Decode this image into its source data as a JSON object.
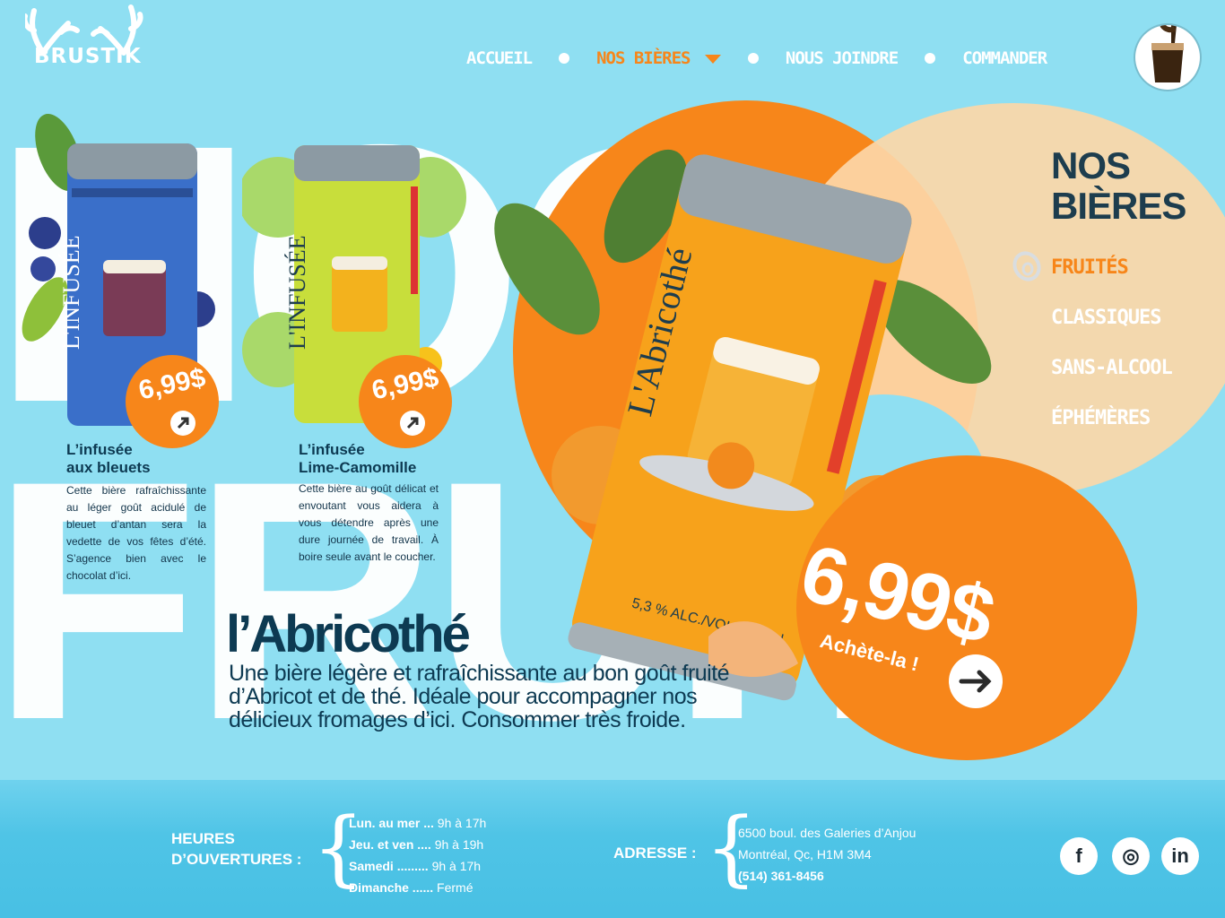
{
  "header": {
    "logo": "BRUSTIK",
    "nav": [
      {
        "label": "ACCUEIL"
      },
      {
        "label": "NOS BIÈRES"
      },
      {
        "label": "NOUS JOINDRE"
      },
      {
        "label": "COMMANDER"
      }
    ]
  },
  "background_words": {
    "top": "HOO",
    "bottom": "FRUIT"
  },
  "categories": {
    "title_line1": "NOS",
    "title_line2": "BIÈRES",
    "items": [
      {
        "label": "FRUITÉS"
      },
      {
        "label": "CLASSIQUES"
      },
      {
        "label": "SANS-ALCOOL"
      },
      {
        "label": "ÉPHÉMÈRES"
      }
    ]
  },
  "products": [
    {
      "title_line1": "L’infusée",
      "title_line2": "aux bleuets",
      "price": "6,99$",
      "description": "Cette bière rafraîchissante au léger goût acidulé de bleuet d’antan sera la vedette de vos fêtes d’été. S’agence bien avec le chocolat d’ici.",
      "can_color": "#3a6fc9"
    },
    {
      "title_line1": "L’infusée",
      "title_line2": "Lime-Camomille",
      "price": "6,99$",
      "description": "Cette bière au goût délicat et envoutant vous aidera à vous détendre après une dure journée de travail. À boire seule avant le coucher.",
      "can_color": "#b9d63a"
    }
  ],
  "featured": {
    "name": "l’Abricothé",
    "description": "Une bière légère et rafraîchissante au bon goût fruité d’Abricot et de thé. Idéale pour accompagner nos délicieux fromages d’ici. Consommer très froide.",
    "price": "6,99$",
    "buy_label": "Achète-la !",
    "can_color": "#f7a21b"
  },
  "footer": {
    "hours_heading_1": "HEURES",
    "hours_heading_2": "D’OUVERTURES :",
    "hours": [
      {
        "day": "Lun. au mer ...",
        "time": "9h à 17h"
      },
      {
        "day": "Jeu. et ven ....",
        "time": "9h à 19h"
      },
      {
        "day": "Samedi .........",
        "time": "9h à 17h"
      },
      {
        "day": "Dimanche ......",
        "time": "Fermé"
      }
    ],
    "address_heading": "ADRESSE :",
    "address_line1": "6500 boul. des Galeries d’Anjou",
    "address_line2": "Montréal, Qc, H1M 3M4",
    "phone": "(514) 361-8456",
    "social": [
      {
        "icon": "facebook-icon",
        "glyph": "f"
      },
      {
        "icon": "instagram-icon",
        "glyph": "◎"
      },
      {
        "icon": "linkedin-icon",
        "glyph": "in"
      }
    ]
  },
  "colors": {
    "accent": "#f7861a",
    "sky": "#8fdff2",
    "navy": "#0d3a52"
  }
}
